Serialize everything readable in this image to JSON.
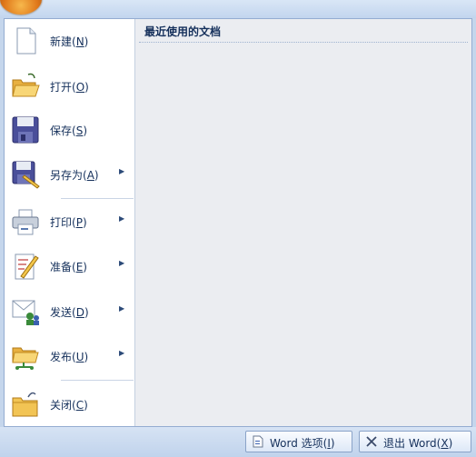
{
  "menu": {
    "items": [
      {
        "pre": "新建(",
        "key": "N",
        "post": ")",
        "icon": "new-document-icon",
        "submenu": false
      },
      {
        "pre": "打开(",
        "key": "O",
        "post": ")",
        "icon": "open-folder-icon",
        "submenu": false
      },
      {
        "pre": "保存(",
        "key": "S",
        "post": ")",
        "icon": "save-disk-icon",
        "submenu": false
      },
      {
        "pre": "另存为(",
        "key": "A",
        "post": ")",
        "icon": "save-as-icon",
        "submenu": true
      },
      {
        "pre": "打印(",
        "key": "P",
        "post": ")",
        "icon": "printer-icon",
        "submenu": true
      },
      {
        "pre": "准备(",
        "key": "E",
        "post": ")",
        "icon": "prepare-icon",
        "submenu": true
      },
      {
        "pre": "发送(",
        "key": "D",
        "post": ")",
        "icon": "send-icon",
        "submenu": true
      },
      {
        "pre": "发布(",
        "key": "U",
        "post": ")",
        "icon": "publish-icon",
        "submenu": true
      },
      {
        "pre": "关闭(",
        "key": "C",
        "post": ")",
        "icon": "close-folder-icon",
        "submenu": false
      }
    ],
    "arrow_glyph": "▶"
  },
  "recent": {
    "title": "最近使用的文档"
  },
  "footer": {
    "options_pre": "Word 选项(",
    "options_key": "I",
    "options_post": ")",
    "exit_pre": "退出 Word(",
    "exit_key": "X",
    "exit_post": ")"
  },
  "colors": {
    "accent": "#15305b",
    "panel_bg": "#ebedf1",
    "frame_bg": "#c5d6ec"
  }
}
